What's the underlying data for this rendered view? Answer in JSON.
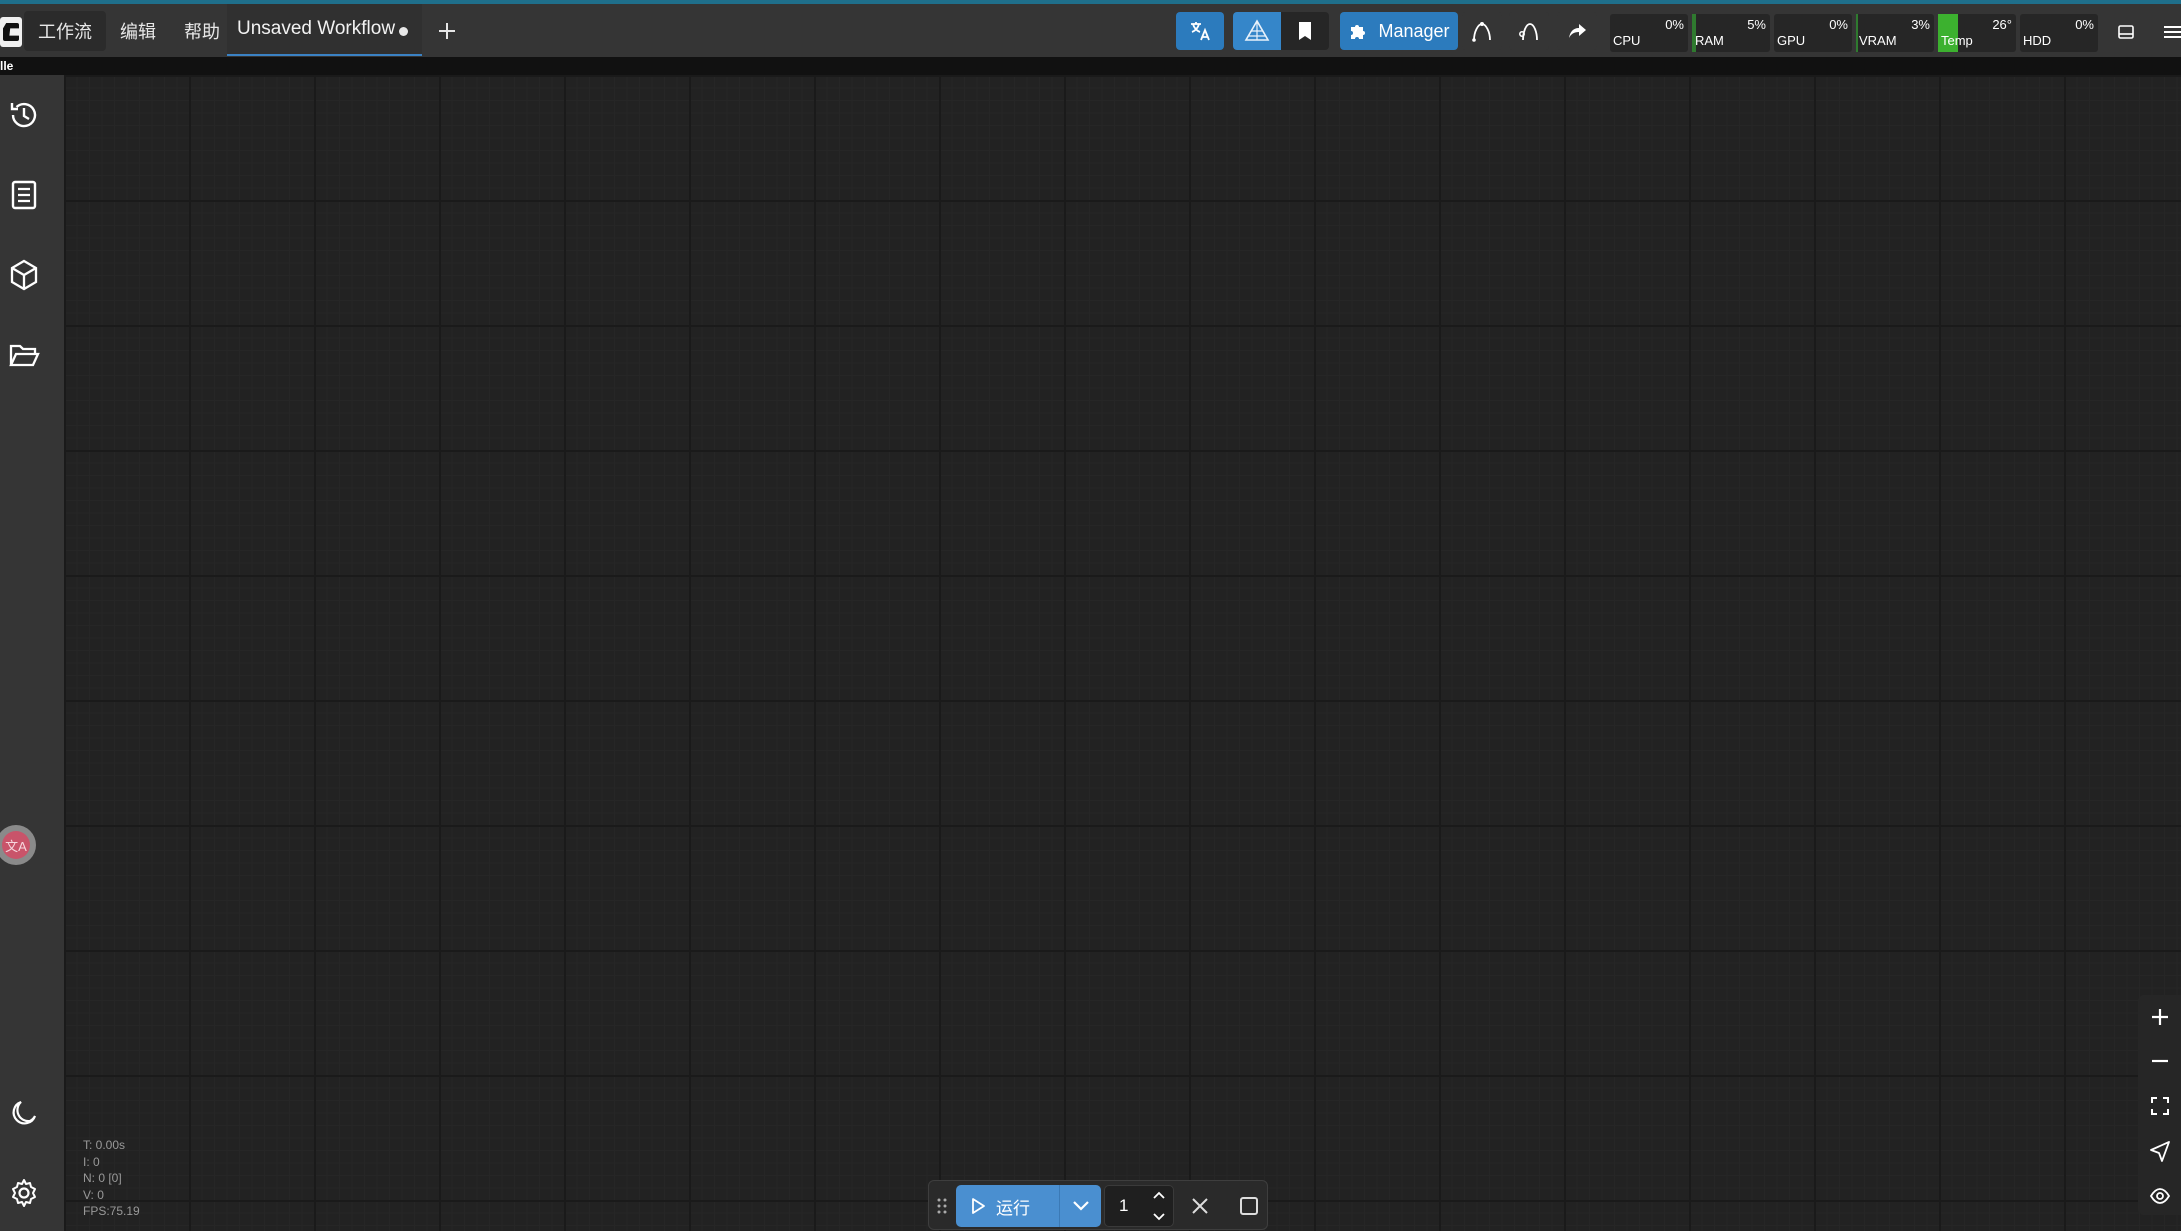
{
  "menu": {
    "items": [
      "工作流",
      "编辑",
      "帮助"
    ]
  },
  "tab": {
    "title": "Unsaved Workflow"
  },
  "toolbar": {
    "manager_label": "Manager"
  },
  "monitors": [
    {
      "label": "CPU",
      "value": "0%",
      "level": 0
    },
    {
      "label": "RAM",
      "value": "5%",
      "level": 5
    },
    {
      "label": "GPU",
      "value": "0%",
      "level": 0
    },
    {
      "label": "VRAM",
      "value": "3%",
      "level": 3
    },
    {
      "label": "Temp",
      "value": "26°",
      "level": 26
    },
    {
      "label": "HDD",
      "value": "0%",
      "level": 0
    }
  ],
  "status_label": "lle",
  "stats": {
    "time": "T: 0.00s",
    "i": "I: 0",
    "n": "N: 0 [0]",
    "v": "V: 0",
    "fps": "FPS:75.19"
  },
  "runbar": {
    "run_label": "运行",
    "batch_count": "1"
  },
  "colors": {
    "accent": "#1f6f8b",
    "run_button": "#4a8fd0",
    "manager_button": "#2c7bbd",
    "temp_fill": "#3cb12f"
  }
}
